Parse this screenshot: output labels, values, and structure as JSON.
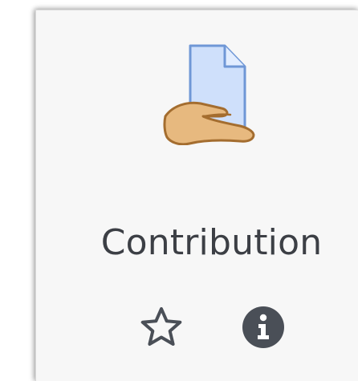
{
  "activity": {
    "title": "Contribution",
    "icon": "document-hand-icon"
  },
  "actions": {
    "star_icon": "star-outline-icon",
    "info_icon": "info-circle-icon"
  },
  "colors": {
    "card_background": "#f7f7f7",
    "title_text": "#3c3f45",
    "icon_dark": "#4a4f57",
    "document_fill": "#cfe0fb",
    "document_stroke": "#6f97d6",
    "hand_fill": "#e7b97f",
    "hand_stroke": "#a46d2f"
  }
}
